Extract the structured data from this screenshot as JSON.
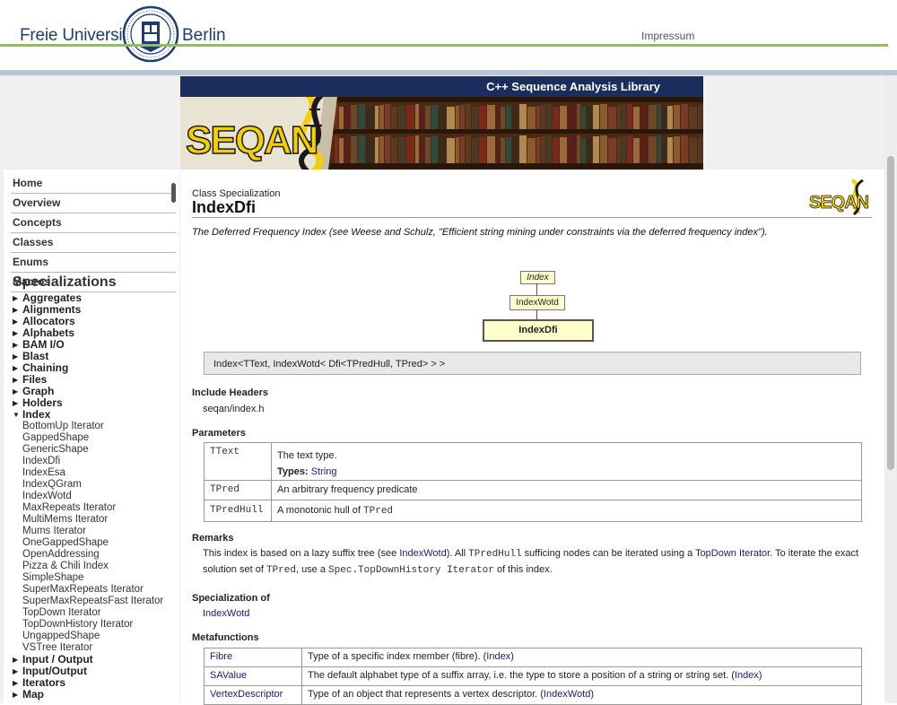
{
  "header": {
    "university_left": "Freie Universität",
    "university_right": "Berlin",
    "impressum": "Impressum"
  },
  "banner": {
    "subtitle": "C++ Sequence Analysis Library",
    "logo_text": "SEQAN"
  },
  "sidebar": {
    "nav": [
      "Home",
      "Overview",
      "Concepts",
      "Classes",
      "Enums",
      "Macros"
    ],
    "specializations_title": "Specializations",
    "categories_before": [
      "Aggregates",
      "Alignments",
      "Allocators",
      "Alphabets",
      "BAM I/O",
      "Blast",
      "Chaining",
      "Files",
      "Graph",
      "Holders"
    ],
    "expanded_category": "Index",
    "index_items": [
      "BottomUp Iterator",
      "GappedShape",
      "GenericShape",
      "IndexDfi",
      "IndexEsa",
      "IndexQGram",
      "IndexWotd",
      "MaxRepeats Iterator",
      "MultiMems Iterator",
      "Mums Iterator",
      "OneGappedShape",
      "OpenAddressing",
      "Pizza & Chili Index",
      "SimpleShape",
      "SuperMaxRepeats Iterator",
      "SuperMaxRepeatsFast Iterator",
      "TopDown Iterator",
      "TopDownHistory Iterator",
      "UngappedShape",
      "VSTree Iterator"
    ],
    "categories_after": [
      "Input / Output",
      "Input/Output",
      "Iterators",
      "Map"
    ]
  },
  "page": {
    "kind": "Class Specialization",
    "title": "IndexDfi",
    "description": "The Deferred Frequency Index (see Weese and Schulz, \"Efficient string mining under constraints via the deferred frequency index\").",
    "diagram": {
      "base": "Index",
      "parent": "IndexWotd",
      "current": "IndexDfi"
    },
    "signature": "Index<TText, IndexWotd< Dfi<TPredHull, TPred> > >",
    "include_headers_title": "Include Headers",
    "include_header": "seqan/index.h",
    "parameters_title": "Parameters",
    "parameters": [
      {
        "name": "TText",
        "desc": "The text type.",
        "types_label": "Types:",
        "types_value": "String"
      },
      {
        "name": "TPred",
        "desc": "An arbitrary frequency predicate"
      },
      {
        "name": "TPredHull",
        "desc": "A monotonic hull of",
        "desc_code": "TPred"
      }
    ],
    "remarks_title": "Remarks",
    "remarks": {
      "p1": "This index is based on a lazy suffix tree (see",
      "link1": "IndexWotd",
      "p2": "). All",
      "code1": "TPredHull",
      "p3": "sufficing nodes can be iterated using a",
      "link2": "TopDown Iterator",
      "p4": ". To iterate the exact solution set of",
      "code2": "TPred",
      "p5": ", use a",
      "code3": "Spec.TopDownHistory Iterator",
      "p6": "of this index."
    },
    "specialization_of_title": "Specialization of",
    "specialization_of": "IndexWotd",
    "metafunctions_title": "Metafunctions",
    "metafunctions": [
      {
        "name": "Fibre",
        "desc": "Type of a specific index member (fibre). (",
        "link": "Index",
        "end": ")"
      },
      {
        "name": "SAValue",
        "desc": "The default alphabet type of a suffix array, i.e. the type to store a position of a string or string set. (",
        "link": "Index",
        "end": ")"
      },
      {
        "name": "VertexDescriptor",
        "desc": "Type of an object that represents a vertex descriptor. (",
        "link": "IndexWotd",
        "end": ")"
      }
    ]
  },
  "colors": {
    "fu_blue": "#1d3d6e",
    "fu_green": "#8cc63e",
    "banner_navy": "#1a2d5c",
    "seqan_yellow": "#f5d000",
    "link": "#1a1a80",
    "diagram_fill": "#ffffcc"
  }
}
